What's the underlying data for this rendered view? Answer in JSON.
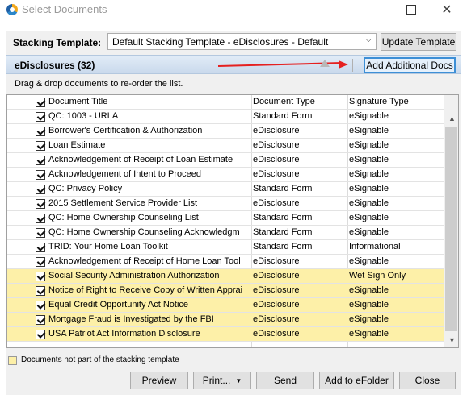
{
  "window": {
    "title": "Select Documents",
    "minimize_glyph": "—",
    "maximize_glyph": "☐",
    "close_glyph": "✕"
  },
  "stacking": {
    "label": "Stacking Template:",
    "selected": "Default Stacking Template - eDisclosures - Default",
    "update_button": "Update Template"
  },
  "section": {
    "title": "eDisclosures (32)",
    "add_button": "Add Additional Docs"
  },
  "instruction": "Drag & drop documents to re-order the list.",
  "columns": {
    "title": "Document Title",
    "type": "Document Type",
    "signature": "Signature Type"
  },
  "rows": [
    {
      "title": "QC: 1003 - URLA",
      "type": "Standard Form",
      "signature": "eSignable",
      "highlighted": false
    },
    {
      "title": "Borrower's Certification & Authorization",
      "type": "eDisclosure",
      "signature": "eSignable",
      "highlighted": false
    },
    {
      "title": "Loan Estimate",
      "type": "eDisclosure",
      "signature": "eSignable",
      "highlighted": false
    },
    {
      "title": "Acknowledgement of Receipt of Loan Estimate",
      "type": "eDisclosure",
      "signature": "eSignable",
      "highlighted": false
    },
    {
      "title": "Acknowledgement of Intent to Proceed",
      "type": "eDisclosure",
      "signature": "eSignable",
      "highlighted": false
    },
    {
      "title": "QC: Privacy Policy",
      "type": "Standard Form",
      "signature": "eSignable",
      "highlighted": false
    },
    {
      "title": "2015 Settlement Service Provider List",
      "type": "eDisclosure",
      "signature": "eSignable",
      "highlighted": false
    },
    {
      "title": "QC: Home Ownership Counseling List",
      "type": "Standard Form",
      "signature": "eSignable",
      "highlighted": false
    },
    {
      "title": "QC: Home Ownership Counseling Acknowledgm",
      "type": "Standard Form",
      "signature": "eSignable",
      "highlighted": false
    },
    {
      "title": "TRID: Your Home Loan Toolkit",
      "type": "Standard Form",
      "signature": "Informational",
      "highlighted": false
    },
    {
      "title": "Acknowledgement of Receipt of Home Loan Tool",
      "type": "eDisclosure",
      "signature": "eSignable",
      "highlighted": false
    },
    {
      "title": "Social Security Administration Authorization",
      "type": "eDisclosure",
      "signature": "Wet Sign Only",
      "highlighted": true
    },
    {
      "title": "Notice of Right to Receive Copy of Written Apprai",
      "type": "eDisclosure",
      "signature": "eSignable",
      "highlighted": true
    },
    {
      "title": "Equal Credit Opportunity Act Notice",
      "type": "eDisclosure",
      "signature": "eSignable",
      "highlighted": true
    },
    {
      "title": "Mortgage Fraud is Investigated by the FBI",
      "type": "eDisclosure",
      "signature": "eSignable",
      "highlighted": true
    },
    {
      "title": "USA Patriot Act Information Disclosure",
      "type": "eDisclosure",
      "signature": "eSignable",
      "highlighted": true
    }
  ],
  "legend": "Documents not part of the stacking template",
  "buttons": {
    "preview": "Preview",
    "print": "Print...",
    "send": "Send",
    "add_efolder": "Add to eFolder",
    "close": "Close"
  },
  "colors": {
    "highlight": "#fdf0a8",
    "section_bar": "#c9d9ec",
    "annotation_arrow": "#e52020",
    "focus_border": "#3d8fd6"
  }
}
